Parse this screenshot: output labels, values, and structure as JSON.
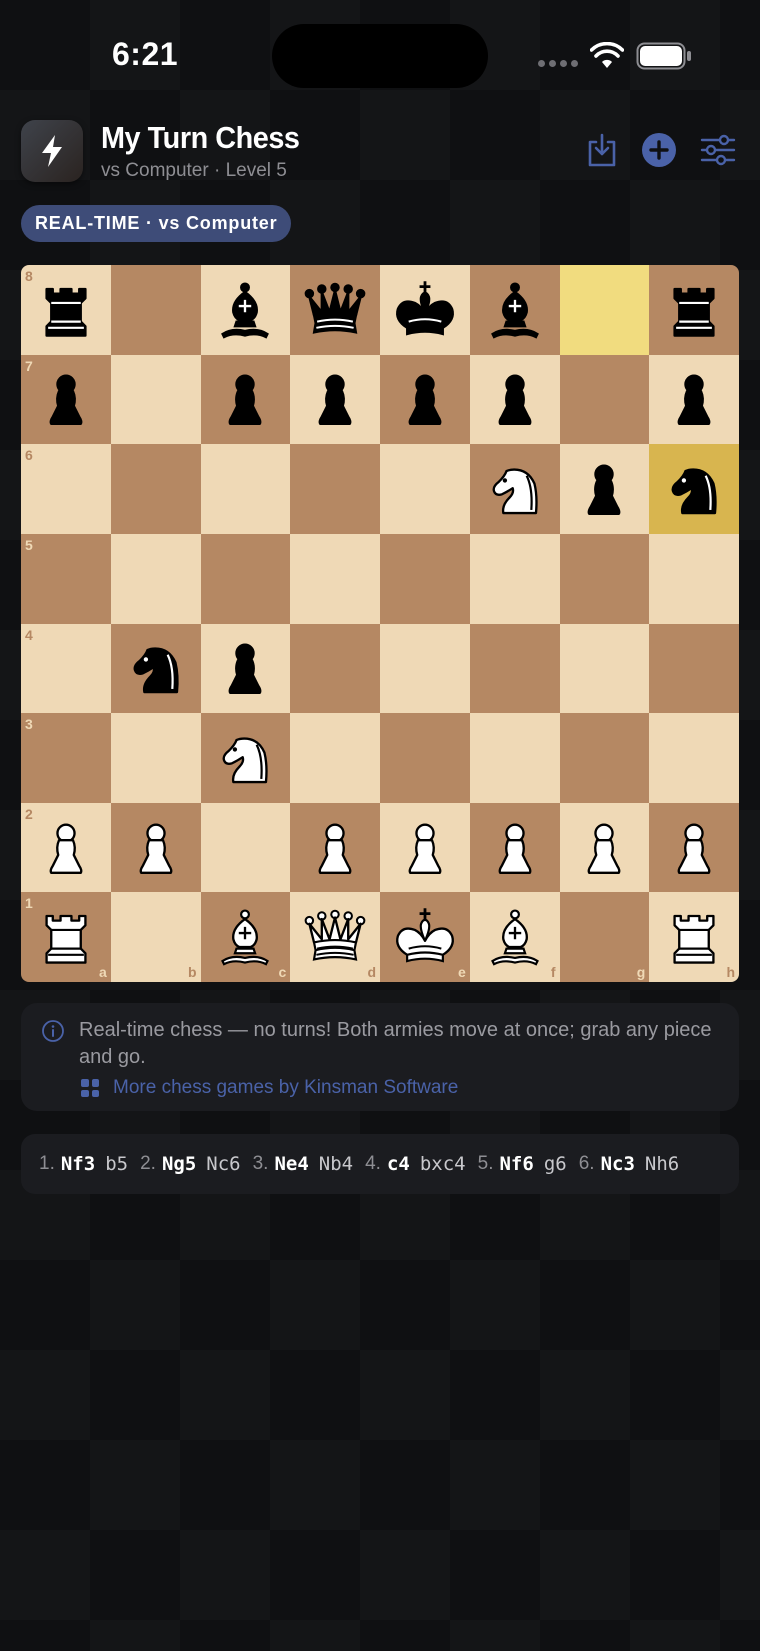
{
  "status_bar": {
    "time": "6:21"
  },
  "header": {
    "title": "My Turn Chess",
    "subtitle": "vs Computer · Level 5",
    "app_icon": "lightning-bolt-icon",
    "buttons": [
      {
        "name": "save-button",
        "icon": "download-tray-icon"
      },
      {
        "name": "new-game-button",
        "icon": "plus-circle-icon"
      },
      {
        "name": "settings-button",
        "icon": "sliders-icon"
      }
    ]
  },
  "mode_badge": "REAL-TIME · vs Computer",
  "board": {
    "files": [
      "a",
      "b",
      "c",
      "d",
      "e",
      "f",
      "g",
      "h"
    ],
    "ranks": [
      "8",
      "7",
      "6",
      "5",
      "4",
      "3",
      "2",
      "1"
    ],
    "highlighted_squares": [
      "g8",
      "h6"
    ],
    "position": [
      [
        "bR",
        "",
        "bB",
        "bQ",
        "bK",
        "bB",
        "",
        "bR"
      ],
      [
        "bP",
        "",
        "bP",
        "bP",
        "bP",
        "bP",
        "",
        "bP"
      ],
      [
        "",
        "",
        "",
        "",
        "",
        "wN",
        "bP",
        "bN"
      ],
      [
        "",
        "",
        "",
        "",
        "",
        "",
        "",
        ""
      ],
      [
        "",
        "bN",
        "bP",
        "",
        "",
        "",
        "",
        ""
      ],
      [
        "",
        "",
        "wN",
        "",
        "",
        "",
        "",
        ""
      ],
      [
        "wP",
        "wP",
        "",
        "wP",
        "wP",
        "wP",
        "wP",
        "wP"
      ],
      [
        "wR",
        "",
        "wB",
        "wQ",
        "wK",
        "wB",
        "",
        "wR"
      ]
    ],
    "colors": {
      "light": "#efd9b6",
      "dark": "#b58863",
      "highlight_light": "#f1dc7f",
      "highlight_dark": "#d8b54f"
    }
  },
  "info": {
    "icon": "info-circle-icon",
    "text": "Real-time chess — no turns! Both armies move at once; grab any piece and go.",
    "link_icon": "app-grid-icon",
    "link_text": "More chess games by Kinsman Software"
  },
  "moves": [
    {
      "num": "1.",
      "white": "Nf3",
      "black": "b5"
    },
    {
      "num": "2.",
      "white": "Ng5",
      "black": "Nc6"
    },
    {
      "num": "3.",
      "white": "Ne4",
      "black": "Nb4"
    },
    {
      "num": "4.",
      "white": "c4",
      "black": "bxc4"
    },
    {
      "num": "5.",
      "white": "Nf6",
      "black": "g6"
    },
    {
      "num": "6.",
      "white": "Nc3",
      "black": "Nh6"
    }
  ],
  "theme": {
    "accent": "#3e4c78",
    "link": "#4a62a8",
    "background": "#0f1012",
    "card": "#1b1c20"
  }
}
